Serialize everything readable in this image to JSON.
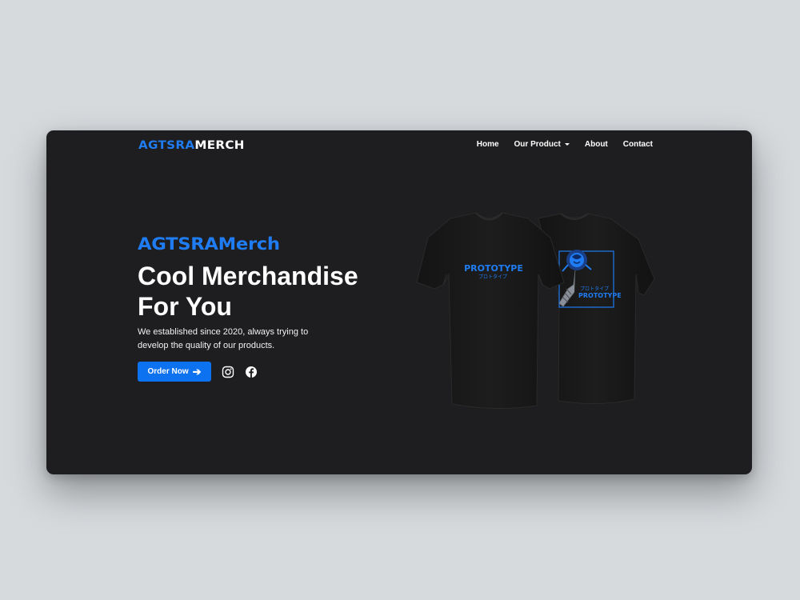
{
  "header": {
    "logo_accent": "AGTSRA",
    "logo_rest": "MERCH",
    "nav": [
      {
        "label": "Home"
      },
      {
        "label": "Our Product"
      },
      {
        "label": "About"
      },
      {
        "label": "Contact"
      }
    ]
  },
  "hero": {
    "brand": "AGTSRAMerch",
    "title_line1": "Cool Merchandise",
    "title_line2": "For You",
    "subtitle": "We established since 2020, always trying to develop the quality of our products.",
    "order_button": "Order Now",
    "social_icons": [
      "instagram-icon",
      "facebook-icon"
    ]
  },
  "product_image": {
    "front_text": "PROTOTYPE",
    "front_jp": "プロトタイプ",
    "back_text": "PROTOTYPE",
    "back_jp": "プロトタイプ"
  },
  "colors": {
    "page_bg": "#d6dadd",
    "card_bg": "#1e1d1f",
    "accent": "#1f7cf2",
    "button": "#0d72ef"
  }
}
